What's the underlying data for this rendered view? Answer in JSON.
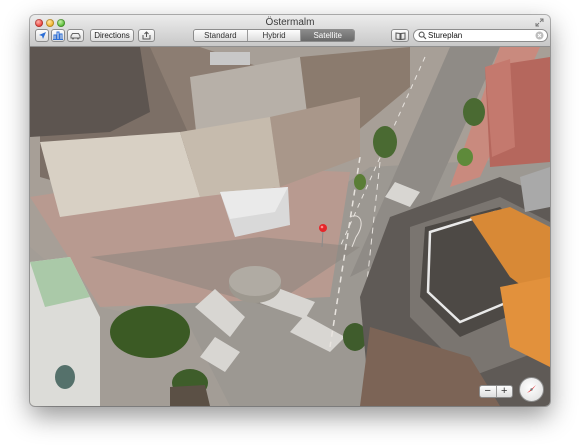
{
  "window": {
    "title": "Östermalm"
  },
  "toolbar": {
    "directions_label": "Directions",
    "map_modes": [
      {
        "label": "Standard",
        "active": false
      },
      {
        "label": "Hybrid",
        "active": false
      },
      {
        "label": "Satellite",
        "active": true
      }
    ],
    "icons": {
      "location": "location-arrow-icon",
      "3d": "3d-buildings-icon",
      "traffic": "traffic-car-icon",
      "share": "share-icon",
      "bookmarks": "bookmarks-icon",
      "search": "search-icon",
      "clear": "clear-search-icon"
    }
  },
  "search": {
    "value": "Stureplan"
  },
  "map": {
    "zoom_out_label": "−",
    "zoom_in_label": "+",
    "pin_color": "#e5262a",
    "active_segment_color": "#7a7a7a"
  }
}
